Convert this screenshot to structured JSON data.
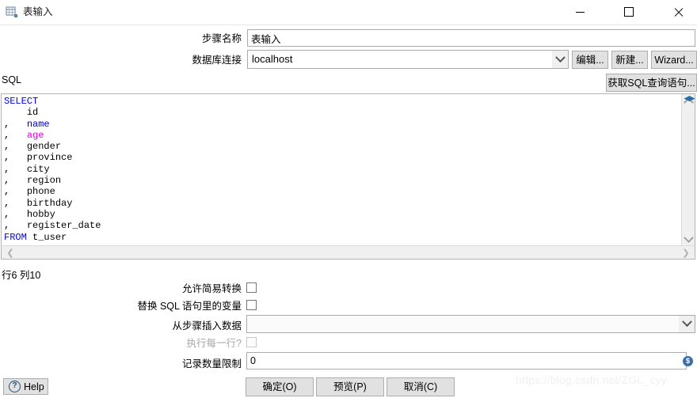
{
  "window": {
    "title": "表输入",
    "icon": "table-icon",
    "minimize_label": "–",
    "maximize_label": "□",
    "close_label": "×"
  },
  "form": {
    "step_name_label": "步骤名称",
    "step_name_value": "表输入",
    "connection_label": "数据库连接",
    "connection_value": "localhost",
    "edit_button": "编辑...",
    "new_button": "新建...",
    "wizard_button": "Wizard...",
    "get_sql_button": "获取SQL查询语句..."
  },
  "sql": {
    "section_label": "SQL",
    "lines": [
      {
        "keyword": "SELECT",
        "comma": "",
        "field": "",
        "field_color": ""
      },
      {
        "keyword": "",
        "comma": "",
        "field": "id",
        "field_color": "plain"
      },
      {
        "keyword": "",
        "comma": ",",
        "field": "name",
        "field_color": "blue"
      },
      {
        "keyword": "",
        "comma": ",",
        "field": "age",
        "field_color": "magenta"
      },
      {
        "keyword": "",
        "comma": ",",
        "field": "gender",
        "field_color": "plain"
      },
      {
        "keyword": "",
        "comma": ",",
        "field": "province",
        "field_color": "plain"
      },
      {
        "keyword": "",
        "comma": ",",
        "field": "city",
        "field_color": "plain"
      },
      {
        "keyword": "",
        "comma": ",",
        "field": "region",
        "field_color": "plain"
      },
      {
        "keyword": "",
        "comma": ",",
        "field": "phone",
        "field_color": "plain"
      },
      {
        "keyword": "",
        "comma": ",",
        "field": "birthday",
        "field_color": "plain"
      },
      {
        "keyword": "",
        "comma": ",",
        "field": "hobby",
        "field_color": "plain"
      },
      {
        "keyword": "",
        "comma": ",",
        "field": "register_date",
        "field_color": "plain"
      },
      {
        "keyword": "FROM",
        "comma": "",
        "field": "t_user",
        "field_color": "plain"
      }
    ],
    "full_text": "SELECT\n    id\n,   name\n,   age\n,   gender\n,   province\n,   city\n,   region\n,   phone\n,   birthday\n,   hobby\n,   register_date\nFROM t_user",
    "cursor_position": "行6 列10",
    "keyword_color": "#0000ee",
    "identifier_color": "#0000cc",
    "highlight_color": "#e800e8"
  },
  "options": {
    "allow_lazy_label": "允许简易转换",
    "allow_lazy_checked": false,
    "replace_vars_label": "替换 SQL 语句里的变量",
    "replace_vars_checked": false,
    "insert_from_step_label": "从步骤插入数据",
    "insert_from_step_value": "",
    "execute_each_row_label": "执行每一行?",
    "execute_each_row_checked": false,
    "execute_each_row_disabled": true,
    "limit_label": "记录数量限制",
    "limit_value": "0"
  },
  "footer": {
    "help_label": "Help",
    "help_icon": "question-mark-icon",
    "ok_button": "确定(O)",
    "preview_button": "预览(P)",
    "cancel_button": "取消(C)"
  },
  "watermark": {
    "text": "https://blog.csdn.net/ZGL_cyy"
  }
}
